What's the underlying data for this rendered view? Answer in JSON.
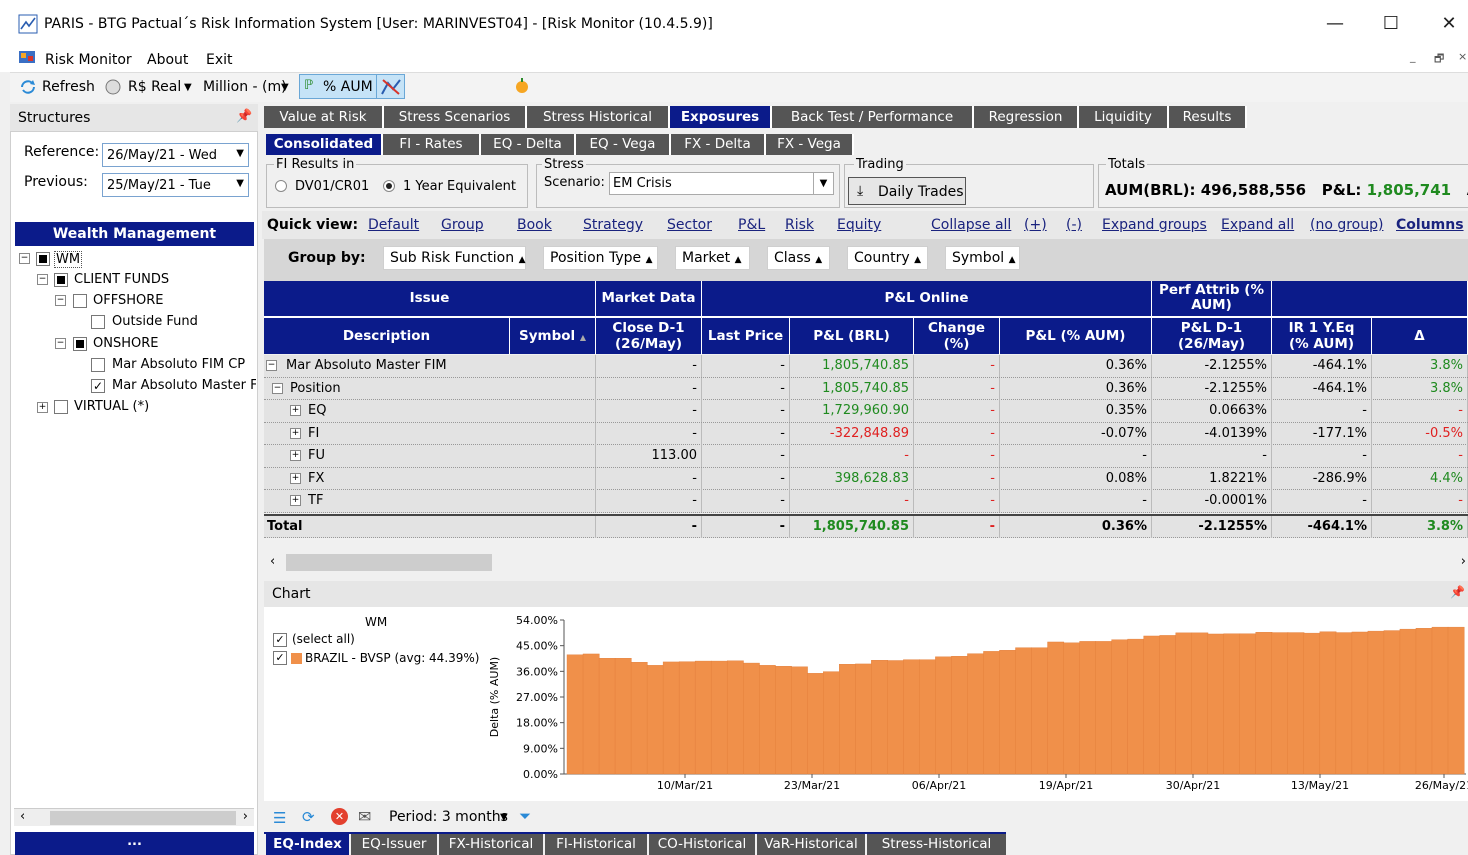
{
  "window": {
    "title": "PARIS - BTG Pactual´s Risk Information System [User: MARINVEST04] - [Risk Monitor (10.4.5.9)]"
  },
  "menu": [
    "Risk Monitor",
    "About",
    "Exit"
  ],
  "toolbar": {
    "refresh": "Refresh",
    "currency": "R$ Real",
    "unit": "Million - (m)",
    "aum": "% AUM"
  },
  "left": {
    "structures": "Structures",
    "reference_label": "Reference:",
    "reference_value": "26/May/21 - Wed",
    "previous_label": "Previous:",
    "previous_value": "25/May/21 - Tue",
    "wm_header": "Wealth Management",
    "tree": [
      "WM",
      "CLIENT FUNDS",
      "OFFSHORE",
      "Outside Fund",
      "ONSHORE",
      "Mar Absoluto FIM CP",
      "Mar Absoluto Master FIM",
      "VIRTUAL (*)"
    ],
    "bottom": "..."
  },
  "tabs": [
    "Value at Risk",
    "Stress Scenarios",
    "Stress Historical",
    "Exposures",
    "Back Test / Performance",
    "Regression",
    "Liquidity",
    "Results"
  ],
  "subtabs": [
    "Consolidated",
    "FI - Rates",
    "EQ - Delta",
    "EQ - Vega",
    "FX - Delta",
    "FX - Vega"
  ],
  "options": {
    "fi_title": "FI Results in",
    "fi_opt1": "DV01/CR01",
    "fi_opt2": "1 Year Equivalent",
    "stress_title": "Stress",
    "scenario_label": "Scenario:",
    "scenario_value": "EM Crisis",
    "trading_title": "Trading",
    "daily_trades": "Daily Trades",
    "totals_title": "Totals",
    "aum_label": "AUM(BRL):",
    "aum_value": "496,588,556",
    "pl_label": "P&L:",
    "pl_value": "1,805,741",
    "trailing": "AU"
  },
  "quick": {
    "label": "Quick view:",
    "links": [
      "Default",
      "Group",
      "Book",
      "Strategy",
      "Sector",
      "P&L",
      "Risk",
      "Equity",
      "Collapse all",
      "(+)",
      "(-)",
      "Expand groups",
      "Expand all",
      "(no group)",
      "Columns"
    ]
  },
  "groupby": {
    "label": "Group by:",
    "buttons": [
      "Sub Risk Function",
      "Position Type",
      "Market",
      "Class",
      "Country",
      "Symbol"
    ]
  },
  "grid": {
    "top_headers": [
      "Issue",
      "Market Data",
      "P&L Online",
      "Perf Attrib (% AUM)"
    ],
    "headers": [
      "Description",
      "Symbol",
      "Close D-1 (26/May)",
      "Last Price",
      "P&L (BRL)",
      "Change (%)",
      "P&L (% AUM)",
      "P&L D-1 (26/May)",
      "IR 1 Y.Eq (% AUM)",
      "Δ"
    ],
    "rows": [
      {
        "desc": "Mar Absoluto Master FIM",
        "close": "-",
        "last": "-",
        "pl": "1,805,740.85",
        "chg": "-",
        "plaum": "0.36%",
        "pld1": "-2.1255%",
        "ir": "-464.1%",
        "delta": "3.8%"
      },
      {
        "desc": "Position",
        "close": "-",
        "last": "-",
        "pl": "1,805,740.85",
        "chg": "-",
        "plaum": "0.36%",
        "pld1": "-2.1255%",
        "ir": "-464.1%",
        "delta": "3.8%"
      },
      {
        "desc": "EQ",
        "close": "-",
        "last": "-",
        "pl": "1,729,960.90",
        "chg": "-",
        "plaum": "0.35%",
        "pld1": "0.0663%",
        "ir": "-",
        "delta": "-"
      },
      {
        "desc": "FI",
        "close": "-",
        "last": "-",
        "pl": "-322,848.89",
        "chg": "-",
        "plaum": "-0.07%",
        "pld1": "-4.0139%",
        "ir": "-177.1%",
        "delta": "-0.5%"
      },
      {
        "desc": "FU",
        "close": "113.00",
        "last": "-",
        "pl": "-",
        "chg": "-",
        "plaum": "-",
        "pld1": "-",
        "ir": "-",
        "delta": "-"
      },
      {
        "desc": "FX",
        "close": "-",
        "last": "-",
        "pl": "398,628.83",
        "chg": "-",
        "plaum": "0.08%",
        "pld1": "1.8221%",
        "ir": "-286.9%",
        "delta": "4.4%"
      },
      {
        "desc": "TF",
        "close": "-",
        "last": "-",
        "pl": "-",
        "chg": "-",
        "plaum": "-",
        "pld1": "-0.0001%",
        "ir": "-",
        "delta": "-"
      }
    ],
    "total": {
      "desc": "Total",
      "close": "-",
      "last": "-",
      "pl": "1,805,740.85",
      "chg": "-",
      "plaum": "0.36%",
      "pld1": "-2.1255%",
      "ir": "-464.1%",
      "delta": "3.8%"
    }
  },
  "chart_panel": {
    "title": "Chart",
    "wm": "WM",
    "select_all": "(select all)",
    "series_label": "BRAZIL - BVSP (avg: 44.39%)",
    "series_color": "#f0904a"
  },
  "chart_data": {
    "type": "bar",
    "ylabel": "Delta (% AUM)",
    "yticks": [
      "54.00%",
      "45.00%",
      "36.00%",
      "27.00%",
      "18.00%",
      "9.00%",
      "0.00%"
    ],
    "ylim": [
      0,
      54
    ],
    "xticks": [
      "10/Mar/21",
      "23/Mar/21",
      "06/Apr/21",
      "19/Apr/21",
      "30/Apr/21",
      "13/May/21",
      "26/May/21"
    ],
    "series": [
      {
        "name": "BRAZIL - BVSP",
        "values": [
          41.8,
          42.1,
          40.6,
          40.6,
          39.2,
          38.1,
          39.3,
          39.4,
          39.6,
          39.6,
          39.7,
          38.9,
          38.1,
          37.8,
          37.6,
          35.3,
          35.9,
          38.5,
          38.6,
          39.9,
          39.8,
          40.1,
          40.1,
          41.1,
          41.3,
          42.2,
          43.0,
          43.4,
          44.3,
          44.3,
          46.3,
          46.0,
          46.5,
          46.5,
          47.1,
          47.3,
          48.4,
          48.6,
          49.5,
          49.5,
          49.1,
          49.2,
          49.2,
          49.7,
          49.6,
          49.6,
          49.4,
          49.9,
          49.6,
          49.8,
          50.1,
          50.3,
          50.8,
          51.1,
          51.5,
          51.5
        ]
      }
    ]
  },
  "bottom": {
    "period": "Period: 3 months",
    "tabs": [
      "EQ-Index",
      "EQ-Issuer",
      "FX-Historical",
      "FI-Historical",
      "CO-Historical",
      "VaR-Historical",
      "Stress-Historical"
    ]
  }
}
